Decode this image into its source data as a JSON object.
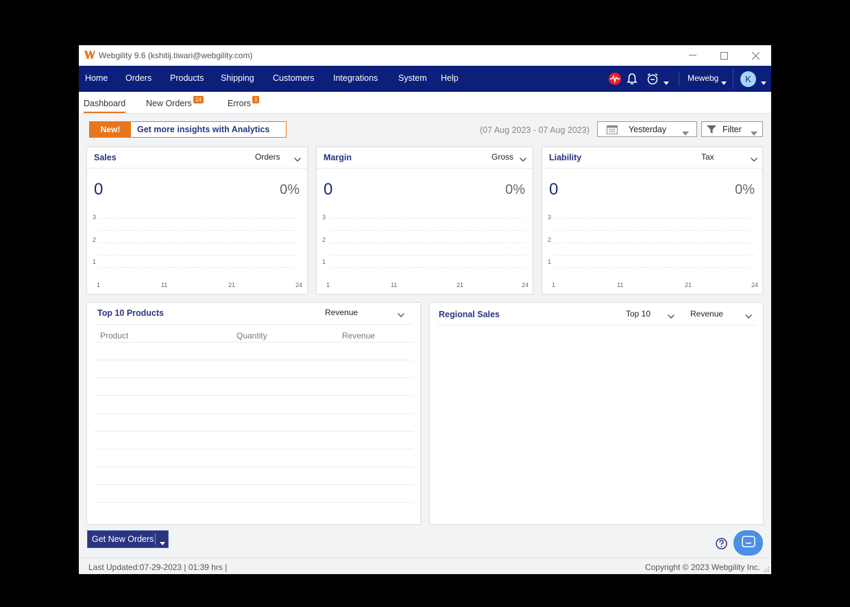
{
  "window": {
    "title": "Webgility 9.6 (kshitij.tiwari@webgility.com)"
  },
  "nav": {
    "items": [
      "Home",
      "Orders",
      "Products",
      "Shipping",
      "Customers",
      "Integrations",
      "System",
      "Help"
    ],
    "account": "Mewebg",
    "avatar_initial": "K"
  },
  "subtabs": {
    "dashboard": "Dashboard",
    "new_orders": "New Orders",
    "new_orders_count": "14",
    "errors": "Errors",
    "errors_count": "1"
  },
  "promo": {
    "badge": "New!",
    "text": "Get more insights with Analytics"
  },
  "date_range": "(07 Aug 2023 - 07 Aug 2023)",
  "date_select": "Yesterday",
  "filter_label": "Filter",
  "cards": {
    "sales": {
      "title": "Sales",
      "select": "Orders",
      "value": "0",
      "pct": "0%"
    },
    "margin": {
      "title": "Margin",
      "select": "Gross",
      "value": "0",
      "pct": "0%"
    },
    "liability": {
      "title": "Liability",
      "select": "Tax",
      "value": "0",
      "pct": "0%"
    }
  },
  "mini_chart": {
    "y_ticks": [
      "3",
      "2",
      "1"
    ],
    "x_ticks": [
      "1",
      "11",
      "21",
      "24"
    ]
  },
  "top_products": {
    "title": "Top 10 Products",
    "select": "Revenue",
    "columns": [
      "Product",
      "Quantity",
      "Revenue"
    ],
    "rows": []
  },
  "regional": {
    "title": "Regional Sales",
    "select_top": "Top 10",
    "select_metric": "Revenue"
  },
  "get_orders_label": "Get New Orders",
  "footer": {
    "last_updated": "Last Updated:07-29-2023 | 01:39 hrs |",
    "copyright": "Copyright © 2023 Webgility Inc."
  },
  "colors": {
    "brand_navy": "#0b1f7b",
    "accent_orange": "#e8761c",
    "title_blue": "#2a3480"
  }
}
